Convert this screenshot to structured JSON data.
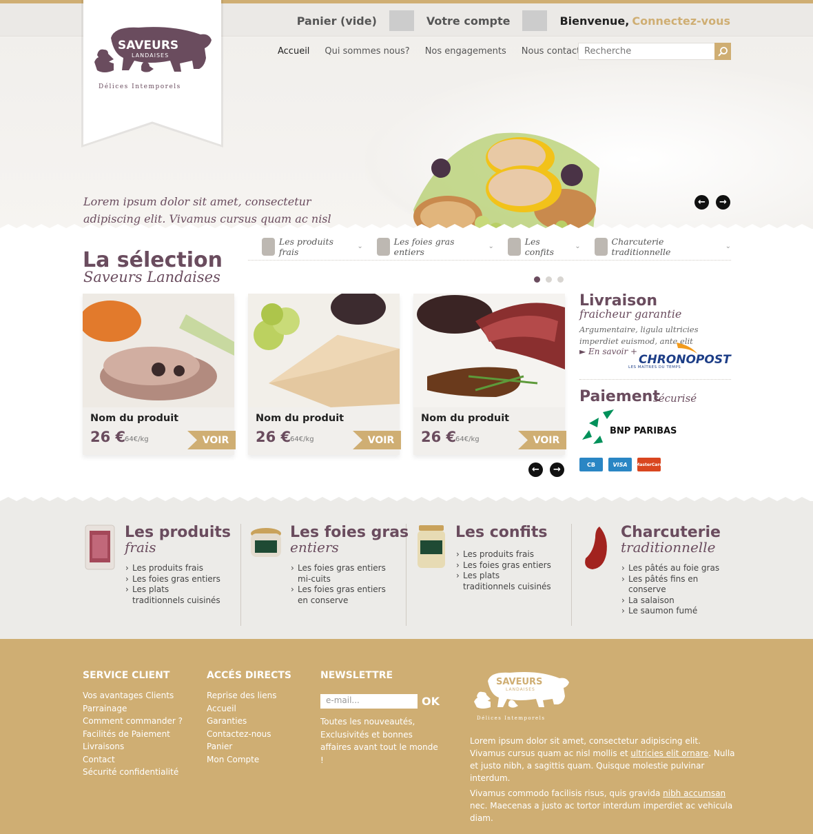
{
  "header": {
    "cart": "Panier (vide)",
    "account": "Votre compte",
    "welcome": "Bienvenue,",
    "connect": "Connectez-vous"
  },
  "nav": [
    "Accueil",
    "Qui sommes nous?",
    "Nos engagements",
    "Nous contacter"
  ],
  "search": {
    "placeholder": "Recherche"
  },
  "logo": {
    "brand": "SAVEURS",
    "sub": "LANDAISES",
    "tagline": "Délices Intemporels"
  },
  "hero": {
    "text": "Lorem ipsum dolor sit amet, consectetur adipiscing elit. Vivamus cursus quam ac nisl mollis et ultricies elit ornare. Nulla et justo nibh, a sagittis quam."
  },
  "category_tabs": [
    "Les produits frais",
    "Les foies gras entiers",
    "Les confits",
    "Charcuterie traditionnelle"
  ],
  "selection": {
    "title": "La sélection",
    "subtitle": "Saveurs Landaises",
    "active_dot": 1,
    "dot_count": 3
  },
  "products": [
    {
      "name": "Nom du produit",
      "price": "26 €",
      "unit": "64€/kg",
      "button": "VOIR"
    },
    {
      "name": "Nom du produit",
      "price": "26 €",
      "unit": "64€/kg",
      "button": "VOIR"
    },
    {
      "name": "Nom du produit",
      "price": "26 €",
      "unit": "64€/kg",
      "button": "VOIR"
    }
  ],
  "livraison": {
    "title": "Livraison",
    "subtitle": "fraicheur garantie",
    "text": "Argumentaire, ligula ultricies imperdiet euismod, ante elit",
    "link": "► En savoir +",
    "carrier": "CHRONOPOST",
    "carrier_tag": "LES MAÎTRES DU TEMPS"
  },
  "paiement": {
    "title": "Paiement",
    "subtitle": "sécurisé",
    "bank": "BNP PARIBAS",
    "cards": [
      {
        "label": "CB",
        "color": "#2a86c4"
      },
      {
        "label": "VISA",
        "color": "#2a86c4"
      },
      {
        "label": "MasterCard",
        "color": "#d9461f"
      }
    ]
  },
  "categories": [
    {
      "title": "Les produits",
      "subtitle": "frais",
      "items": [
        "Les produits frais",
        "Les foies gras entiers",
        "Les plats traditionnels cuisinés"
      ]
    },
    {
      "title": "Les foies gras",
      "subtitle": "entiers",
      "items": [
        "Les foies gras entiers mi-cuits",
        "Les foies gras entiers en conserve"
      ]
    },
    {
      "title": "Les confits",
      "subtitle": "",
      "items": [
        "Les produits frais",
        "Les foies gras entiers",
        "Les plats traditionnels cuisinés"
      ]
    },
    {
      "title": "Charcuterie",
      "subtitle": "traditionnelle",
      "items": [
        "Les pâtés au foie gras",
        "Les pâtés fins en conserve",
        "La salaison",
        "Le saumon fumé"
      ]
    }
  ],
  "footer": {
    "service": {
      "title": "SERVICE CLIENT",
      "items": [
        "Vos avantages Clients",
        "Parrainage",
        "Comment commander ?",
        "Facilités de Paiement",
        "Livraisons",
        "Contact",
        "Sécurité confidentialité"
      ]
    },
    "acces": {
      "title": "ACCÉS DIRECTS",
      "items": [
        "Reprise des liens",
        "Accueil",
        "Garanties",
        "Contactez-nous",
        "Panier",
        "Mon Compte"
      ]
    },
    "newsletter": {
      "title": "NEWSLETTRE",
      "placeholder": "e-mail...",
      "ok": "OK",
      "text": "Toutes les nouveautés, Exclusivités et bonnes affaires avant tout le monde !"
    },
    "about1_a": "Lorem ipsum dolor sit amet, consectetur adipiscing elit. Vivamus cursus quam ac nisl mollis et ",
    "about1_link": "ultricies elit ornare",
    "about1_b": ". Nulla et justo nibh, a sagittis quam. Quisque molestie pulvinar interdum.",
    "about2_a": "Vivamus commodo facilisis risus, quis gravida ",
    "about2_link": "nibh accumsan",
    "about2_b": " nec. Maecenas a justo ac tortor interdum imperdiet ac vehicula diam."
  },
  "colors": {
    "accent": "#cfae73",
    "brand": "#6a4c5e"
  }
}
